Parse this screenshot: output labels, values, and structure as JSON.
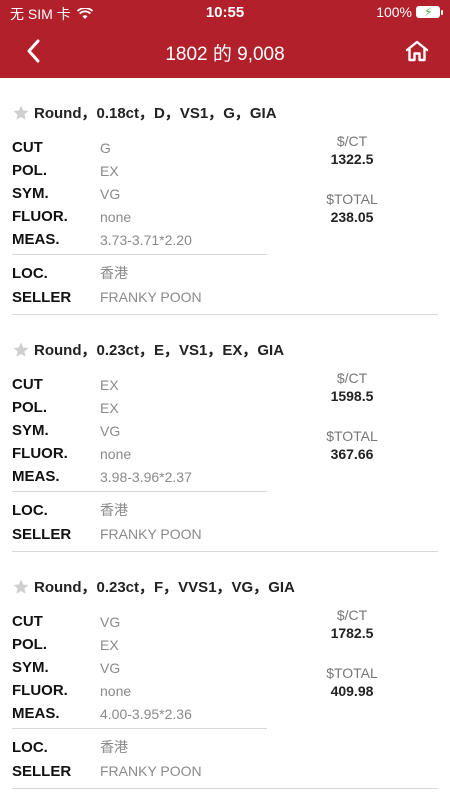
{
  "status": {
    "carrier": "无 SIM 卡",
    "time": "10:55",
    "battery": "100%"
  },
  "nav": {
    "title": "1802 的 9,008"
  },
  "labels": {
    "cut": "CUT",
    "pol": "POL.",
    "sym": "SYM.",
    "fluor": "FLUOR.",
    "meas": "MEAS.",
    "loc": "LOC.",
    "seller": "SELLER",
    "per_ct": "$/CT",
    "total": "$TOTAL"
  },
  "items": [
    {
      "title": "Round，0.18ct，D，VS1，G，GIA",
      "cut": "G",
      "pol": "EX",
      "sym": "VG",
      "fluor": "none",
      "meas": "3.73-3.71*2.20",
      "loc": "香港",
      "seller": "FRANKY POON",
      "per_ct": "1322.5",
      "total": "238.05"
    },
    {
      "title": "Round，0.23ct，E，VS1，EX，GIA",
      "cut": "EX",
      "pol": "EX",
      "sym": "VG",
      "fluor": "none",
      "meas": "3.98-3.96*2.37",
      "loc": "香港",
      "seller": "FRANKY POON",
      "per_ct": "1598.5",
      "total": "367.66"
    },
    {
      "title": "Round，0.23ct，F，VVS1，VG，GIA",
      "cut": "VG",
      "pol": "EX",
      "sym": "VG",
      "fluor": "none",
      "meas": "4.00-3.95*2.36",
      "loc": "香港",
      "seller": "FRANKY POON",
      "per_ct": "1782.5",
      "total": "409.98"
    }
  ],
  "colors": {
    "brand": "#b2202b",
    "star": "#cfcfcf",
    "muted_value": "#8a8a8a"
  }
}
